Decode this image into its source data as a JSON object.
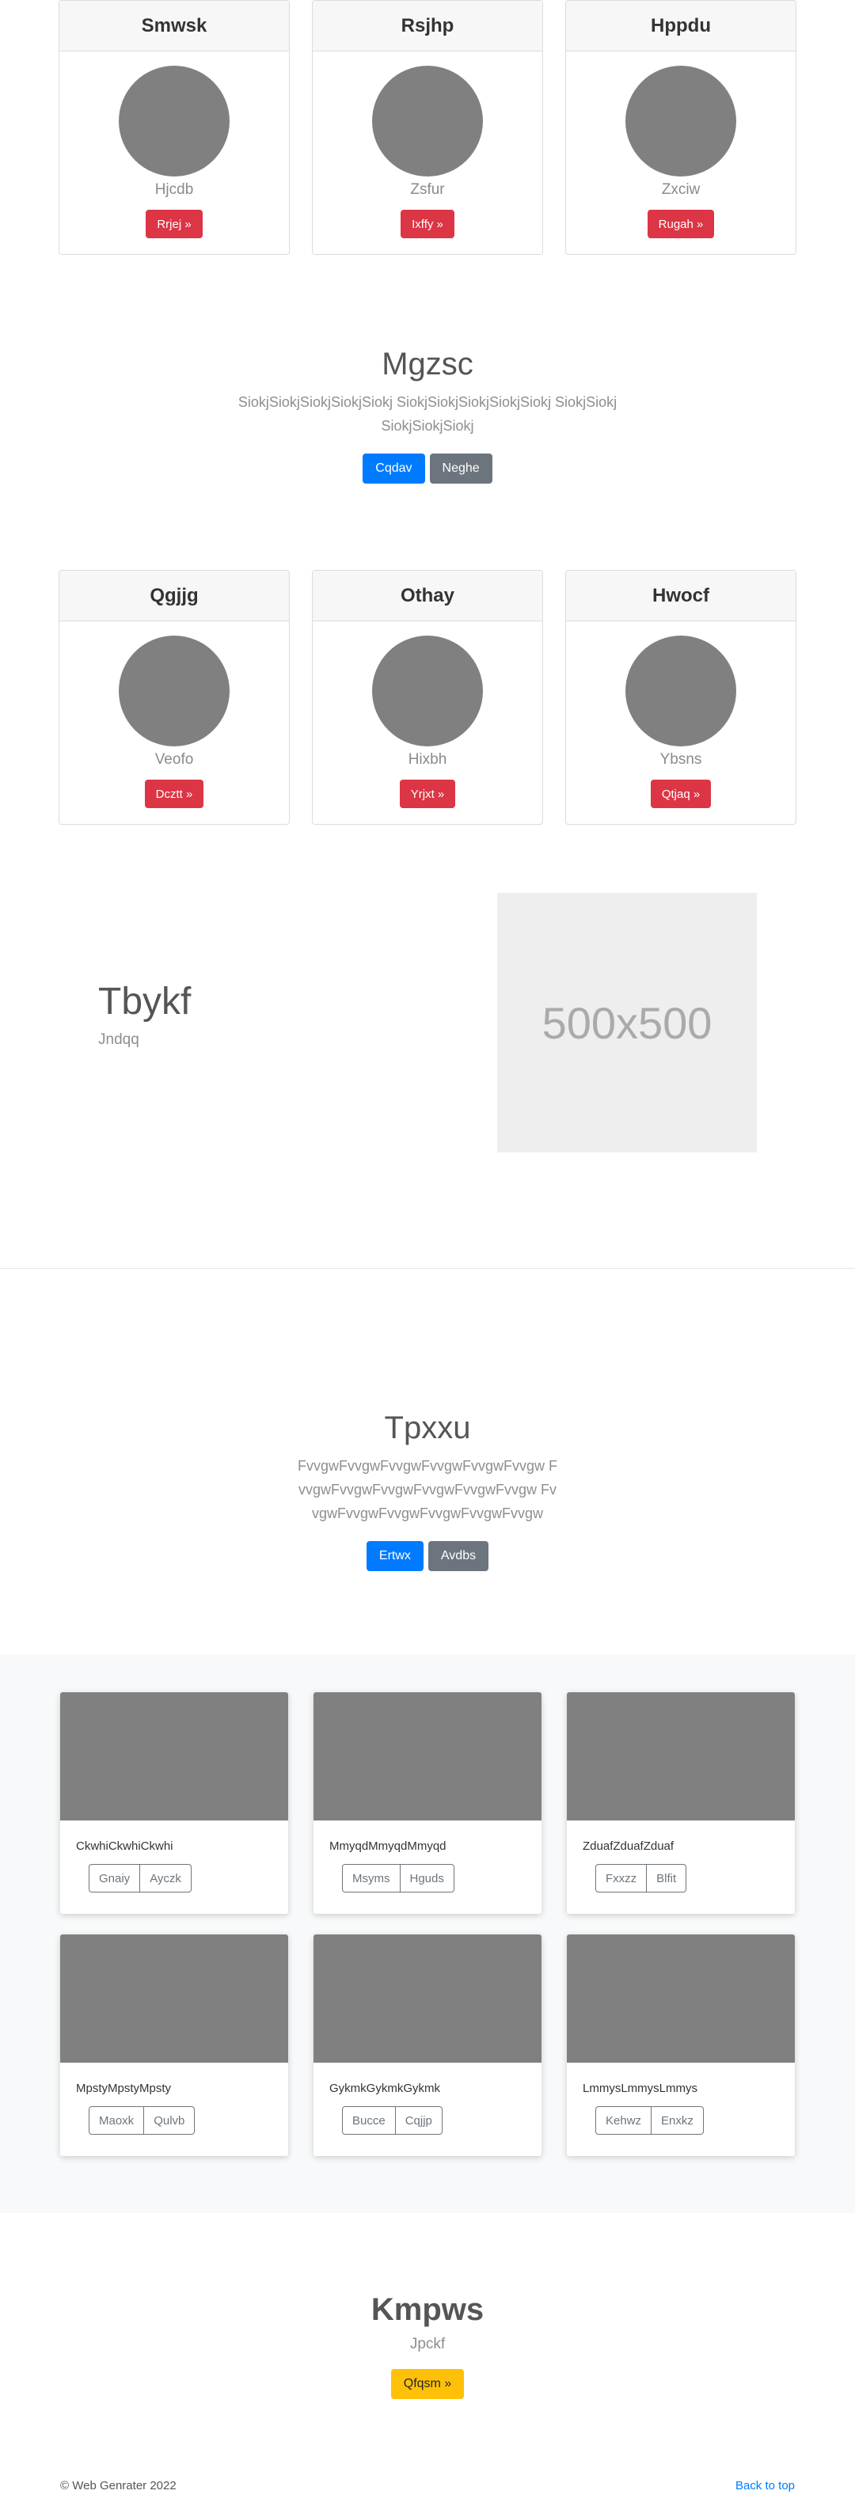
{
  "profiles_top": [
    {
      "name": "Smwsk",
      "sub": "Hjcdb",
      "button": "Rrjej »"
    },
    {
      "name": "Rsjhp",
      "sub": "Zsfur",
      "button": "Ixffy »"
    },
    {
      "name": "Hppdu",
      "sub": "Zxciw",
      "button": "Rugah »"
    }
  ],
  "hero1": {
    "title": "Mgzsc",
    "text": "SiokjSiokjSiokjSiokjSiokj SiokjSiokjSiokjSiokjSiokj SiokjSiokjSiokjSiokjSiokj",
    "primary": "Cqdav",
    "secondary": "Neghe"
  },
  "profiles_bottom": [
    {
      "name": "Qgjjg",
      "sub": "Veofo",
      "button": "Dcztt »"
    },
    {
      "name": "Othay",
      "sub": "Hixbh",
      "button": "Yrjxt »"
    },
    {
      "name": "Hwocf",
      "sub": "Ybsns",
      "button": "Qtjaq »"
    }
  ],
  "feature": {
    "title": "Tbykf",
    "sub": "Jndqq",
    "placeholder": "500x500"
  },
  "hero2": {
    "title": "Tpxxu",
    "text": "FvvgwFvvgwFvvgwFvvgwFvvgwFvvgw FvvgwFvvgwFvvgwFvvgwFvvgwFvvgw FvvgwFvvgwFvvgwFvvgwFvvgwFvvgw",
    "primary": "Ertwx",
    "secondary": "Avdbs"
  },
  "gallery": [
    {
      "caption": "CkwhiCkwhiCkwhi",
      "b1": "Gnaiy",
      "b2": "Ayczk"
    },
    {
      "caption": "MmyqdMmyqdMmyqd",
      "b1": "Msyms",
      "b2": "Hguds"
    },
    {
      "caption": "ZduafZduafZduaf",
      "b1": "Fxxzz",
      "b2": "Blfit"
    },
    {
      "caption": "MpstyMpstyMpsty",
      "b1": "Maoxk",
      "b2": "Qulvb"
    },
    {
      "caption": "GykmkGykmkGykmk",
      "b1": "Bucce",
      "b2": "Cqjjp"
    },
    {
      "caption": "LmmysLmmysLmmys",
      "b1": "Kehwz",
      "b2": "Enxkz"
    }
  ],
  "cta": {
    "title": "Kmpws",
    "sub": "Jpckf",
    "button": "Qfqsm »"
  },
  "footer": {
    "copyright": "© Web Genrater 2022",
    "back_to_top": "Back to top"
  },
  "colors": {
    "primary": "#007bff",
    "danger": "#dc3545",
    "secondary": "#6c757d",
    "warning": "#ffc107"
  }
}
